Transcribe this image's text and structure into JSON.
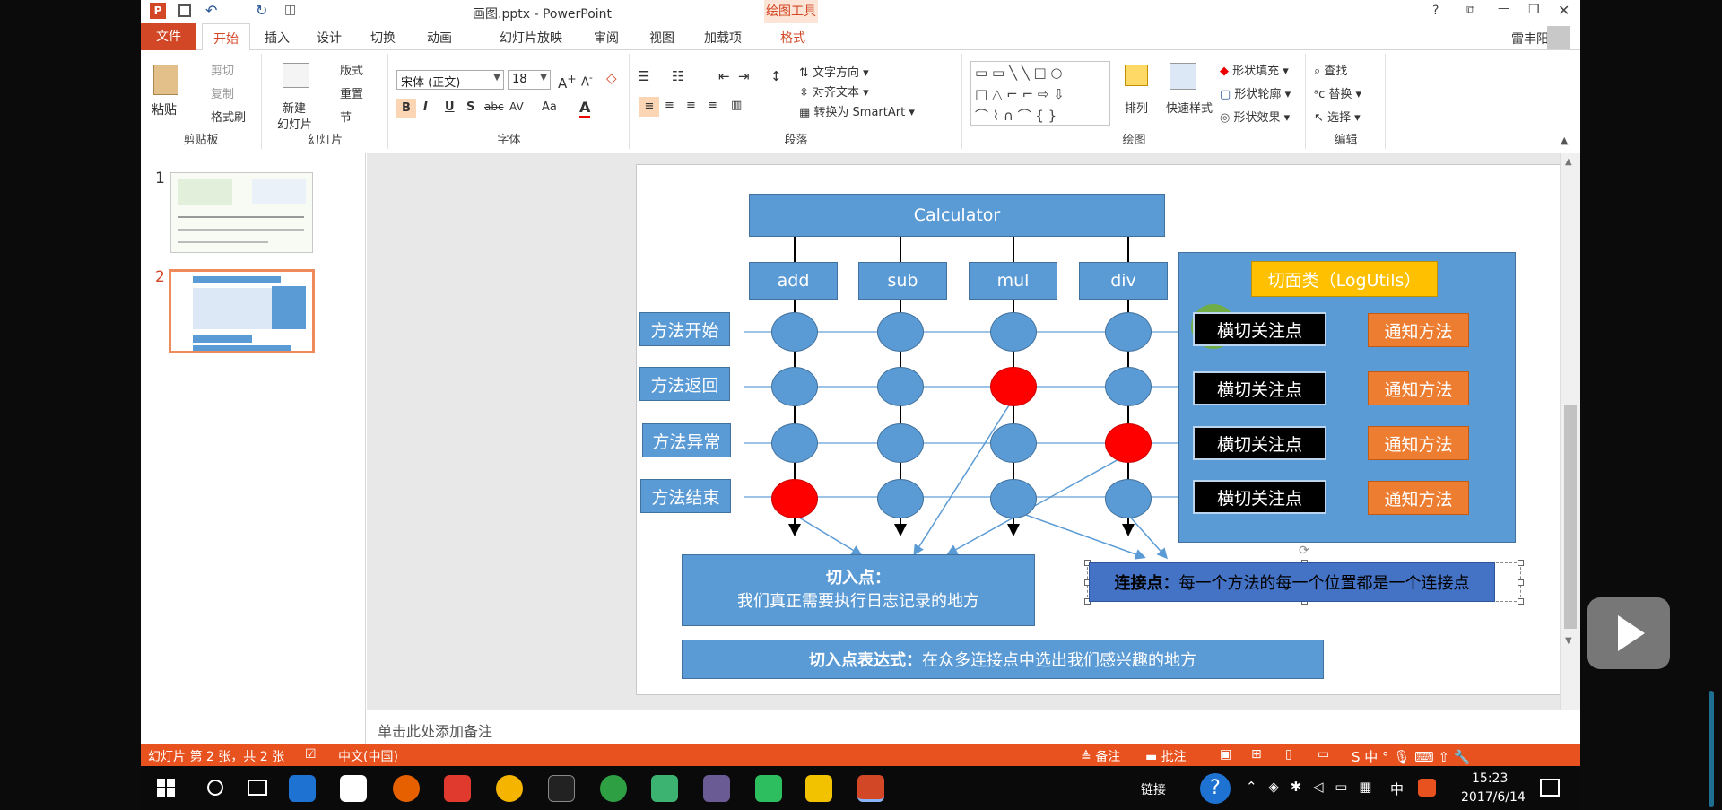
{
  "app": {
    "filename": "画图.pptx - PowerPoint",
    "contextual_tab": "绘图工具",
    "user": "雷丰阳",
    "window_controls": [
      "?",
      "⧉",
      "—",
      "❐",
      "✕"
    ]
  },
  "tabs": [
    "文件",
    "开始",
    "插入",
    "设计",
    "切换",
    "动画",
    "幻灯片放映",
    "审阅",
    "视图",
    "加载项",
    "格式"
  ],
  "ribbon": {
    "clipboard": {
      "paste": "粘贴",
      "cut": "剪切",
      "copy": "复制",
      "format_painter": "格式刷",
      "label": "剪贴板"
    },
    "slides": {
      "new_slide": "新建",
      "new_slide2": "幻灯片",
      "layout": "版式",
      "reset": "重置",
      "section": "节",
      "label": "幻灯片"
    },
    "font": {
      "font_name": "宋体 (正文)",
      "font_size": "18",
      "label": "字体",
      "bold": "B",
      "italic": "I",
      "underline": "U",
      "shadow": "S",
      "strike": "abc",
      "spacing": "AV",
      "case": "Aa",
      "color": "A"
    },
    "paragraph": {
      "text_direction": "文字方向",
      "align_text": "对齐文本",
      "smartart": "转换为 SmartArt",
      "label": "段落"
    },
    "drawing": {
      "arrange": "排列",
      "quick_styles": "快速样式",
      "fill": "形状填充",
      "outline": "形状轮廓",
      "effects": "形状效果",
      "label": "绘图"
    },
    "editing": {
      "find": "查找",
      "replace": "替换",
      "select": "选择",
      "label": "编辑"
    }
  },
  "thumbnails": [
    {
      "num": "1"
    },
    {
      "num": "2"
    }
  ],
  "slide": {
    "calculator": "Calculator",
    "methods": [
      "add",
      "sub",
      "mul",
      "div"
    ],
    "rows": [
      "方法开始",
      "方法返回",
      "方法异常",
      "方法结束"
    ],
    "aspect_title": "切面类（LogUtils）",
    "concern": "横切关注点",
    "advice": "通知方法",
    "pointcut_title": "切入点：",
    "pointcut_desc": "我们真正需要执行日志记录的地方",
    "joinpoint_bold": "连接点：",
    "joinpoint_desc": "每一个方法的每一个位置都是一个连接点",
    "expr_bold": "切入点表达式：",
    "expr_desc": "在众多连接点中选出我们感兴趣的地方"
  },
  "notes_placeholder": "单击此处添加备注",
  "status": {
    "slide_info": "幻灯片 第 2 张，共 2 张",
    "language": "中文(中国)",
    "notes": "备注",
    "comments": "批注"
  },
  "taskbar": {
    "link_label": "链接",
    "time": "15:23",
    "date": "2017/6/14",
    "ime": "中"
  }
}
